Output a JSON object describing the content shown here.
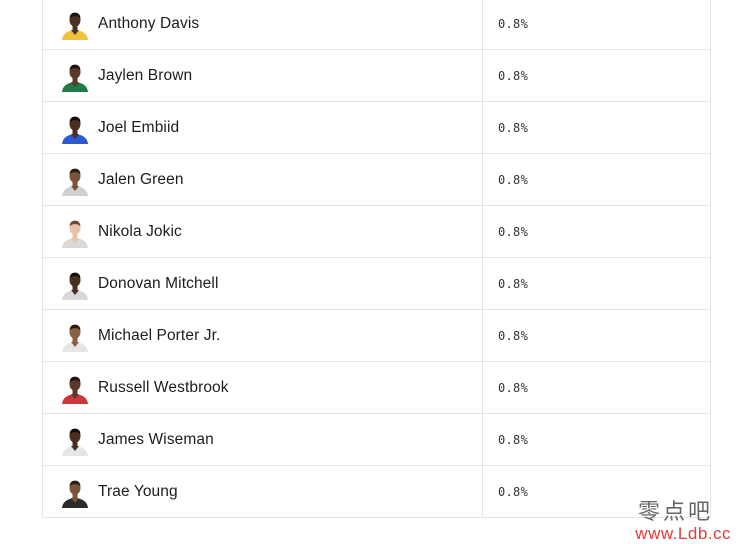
{
  "rows": [
    {
      "name": "Anthony Davis",
      "pct": "0.8%",
      "skin": "#4a3122",
      "jersey": "#f2c23a",
      "hair": "#1a120c"
    },
    {
      "name": "Jaylen Brown",
      "pct": "0.8%",
      "skin": "#5a3a27",
      "jersey": "#1f7a45",
      "hair": "#1a120c"
    },
    {
      "name": "Joel Embiid",
      "pct": "0.8%",
      "skin": "#4a2f20",
      "jersey": "#2a5bd1",
      "hair": "#120c08"
    },
    {
      "name": "Jalen Green",
      "pct": "0.8%",
      "skin": "#7a5238",
      "jersey": "#d0d0d0",
      "hair": "#2a1c12"
    },
    {
      "name": "Nikola Jokic",
      "pct": "0.8%",
      "skin": "#e8c3a8",
      "jersey": "#d9d9d9",
      "hair": "#6b4a2f"
    },
    {
      "name": "Donovan Mitchell",
      "pct": "0.8%",
      "skin": "#4a2f20",
      "jersey": "#d8d8d8",
      "hair": "#140e0a"
    },
    {
      "name": "Michael Porter Jr.",
      "pct": "0.8%",
      "skin": "#8a5e40",
      "jersey": "#e6e6e6",
      "hair": "#2a1c12"
    },
    {
      "name": "Russell Westbrook",
      "pct": "0.8%",
      "skin": "#5a3a27",
      "jersey": "#c83a3a",
      "hair": "#1a120c"
    },
    {
      "name": "James Wiseman",
      "pct": "0.8%",
      "skin": "#4a2f20",
      "jersey": "#e6e6e6",
      "hair": "#120c08"
    },
    {
      "name": "Trae Young",
      "pct": "0.8%",
      "skin": "#7a5238",
      "jersey": "#2a2a2a",
      "hair": "#2a1c12"
    }
  ],
  "watermark": {
    "chinese": "零点吧",
    "url": "www.Ldb.cc"
  }
}
